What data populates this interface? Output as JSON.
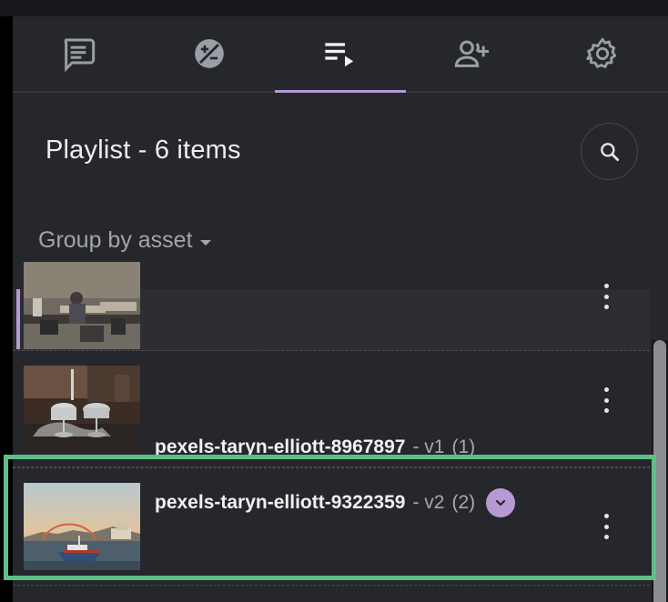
{
  "tabs": [
    {
      "icon": "chat-icon",
      "active": false
    },
    {
      "icon": "compare-icon",
      "active": false
    },
    {
      "icon": "playlist-icon",
      "active": true
    },
    {
      "icon": "add-user-icon",
      "active": false
    },
    {
      "icon": "gear-icon",
      "active": false
    }
  ],
  "header": {
    "title": "Playlist - 6 items",
    "group_by_label": "Group by asset"
  },
  "playlist": {
    "items": [
      {
        "name": "",
        "version": "",
        "count": ""
      },
      {
        "name": "pexels-taryn-elliott-8967897",
        "version": "- v1",
        "count": "(1)"
      },
      {
        "name": "pexels-taryn-elliott-9322359",
        "version": "- v2",
        "count": "(2)"
      }
    ]
  },
  "colors": {
    "accent": "#b79ad4",
    "highlight": "#5fbf86",
    "panel_bg": "#25272c"
  }
}
